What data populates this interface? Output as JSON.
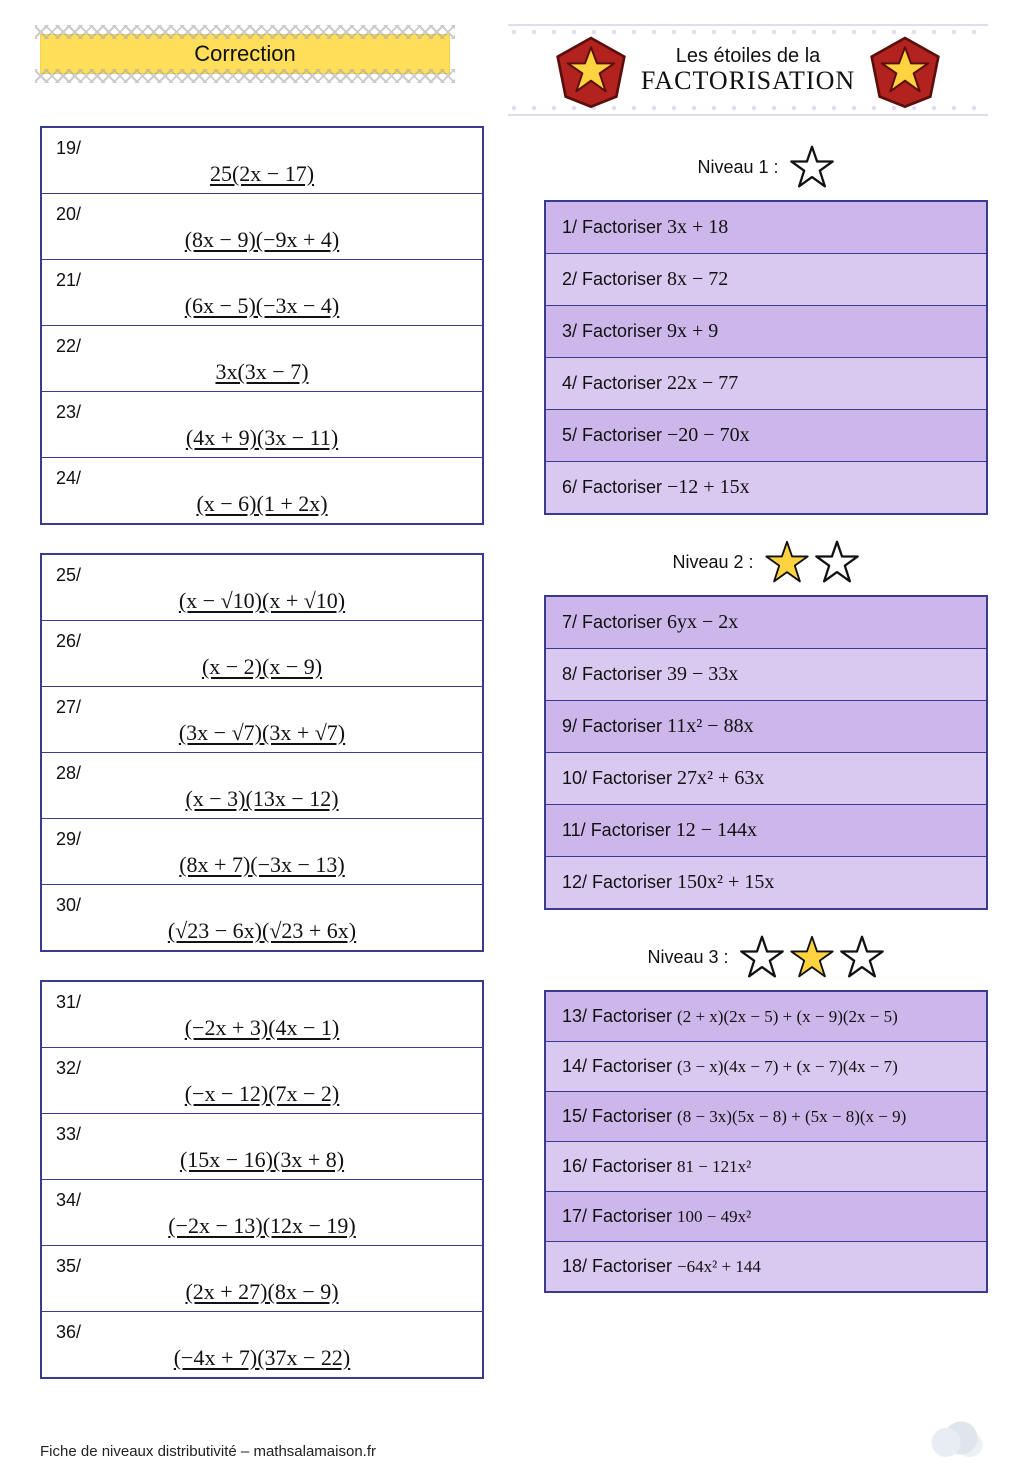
{
  "header": {
    "correction_label": "Correction",
    "title_line1": "Les étoiles de la",
    "title_line2": "FACTORISATION"
  },
  "niveaux": {
    "label1": "Niveau 1 :",
    "label2": "Niveau 2 :",
    "label3": "Niveau 3 :"
  },
  "answers_block1": [
    {
      "num": "19/",
      "expr": "25(2x − 17)"
    },
    {
      "num": "20/",
      "expr": "(8x − 9)(−9x + 4)"
    },
    {
      "num": "21/",
      "expr": "(6x − 5)(−3x − 4)"
    },
    {
      "num": "22/",
      "expr": "3x(3x − 7)"
    },
    {
      "num": "23/",
      "expr": "(4x + 9)(3x − 11)"
    },
    {
      "num": "24/",
      "expr": "(x − 6)(1 + 2x)"
    }
  ],
  "answers_block2": [
    {
      "num": "25/",
      "expr": "(x − √10)(x + √10)"
    },
    {
      "num": "26/",
      "expr": "(x − 2)(x − 9)"
    },
    {
      "num": "27/",
      "expr": "(3x − √7)(3x + √7)"
    },
    {
      "num": "28/",
      "expr": "(x − 3)(13x − 12)"
    },
    {
      "num": "29/",
      "expr": "(8x + 7)(−3x − 13)"
    },
    {
      "num": "30/",
      "expr": "(√23 − 6x)(√23 + 6x)"
    }
  ],
  "answers_block3": [
    {
      "num": "31/",
      "expr": "(−2x + 3)(4x − 1)"
    },
    {
      "num": "32/",
      "expr": "(−x − 12)(7x − 2)"
    },
    {
      "num": "33/",
      "expr": "(15x − 16)(3x + 8)"
    },
    {
      "num": "34/",
      "expr": "(−2x − 13)(12x − 19)"
    },
    {
      "num": "35/",
      "expr": "(2x + 27)(8x − 9)"
    },
    {
      "num": "36/",
      "expr": "(−4x + 7)(37x − 22)"
    }
  ],
  "level1": [
    {
      "label": "1/ Factoriser",
      "expr": "3x + 18"
    },
    {
      "label": "2/ Factoriser",
      "expr": "8x − 72"
    },
    {
      "label": "3/ Factoriser",
      "expr": "9x + 9"
    },
    {
      "label": "4/ Factoriser",
      "expr": "22x − 77"
    },
    {
      "label": "5/ Factoriser",
      "expr": "−20 − 70x"
    },
    {
      "label": "6/ Factoriser",
      "expr": "−12 + 15x"
    }
  ],
  "level2": [
    {
      "label": "7/ Factoriser",
      "expr": "6yx − 2x"
    },
    {
      "label": "8/ Factoriser",
      "expr": "39 − 33x"
    },
    {
      "label": "9/ Factoriser",
      "expr": "11x² − 88x"
    },
    {
      "label": "10/ Factoriser",
      "expr": "27x² + 63x"
    },
    {
      "label": "11/ Factoriser",
      "expr": "12 − 144x"
    },
    {
      "label": "12/ Factoriser",
      "expr": "150x² + 15x"
    }
  ],
  "level3": [
    {
      "label": "13/ Factoriser",
      "expr": "(2 + x)(2x − 5) + (x − 9)(2x − 5)"
    },
    {
      "label": "14/ Factoriser",
      "expr": "(3 − x)(4x − 7) + (x − 7)(4x − 7)"
    },
    {
      "label": "15/ Factoriser",
      "expr": "(8 − 3x)(5x − 8) + (5x − 8)(x − 9)"
    },
    {
      "label": "16/ Factoriser",
      "expr": "81 − 121x²"
    },
    {
      "label": "17/ Factoriser",
      "expr": "100 − 49x²"
    },
    {
      "label": "18/ Factoriser",
      "expr": "−64x² + 144"
    }
  ],
  "footer": {
    "text": "Fiche de niveaux distributivité  – mathsalamaison.fr"
  },
  "colors": {
    "banner": "#ffde59",
    "frame": "#3a3a8f",
    "row_odd": "#cdb7ea",
    "row_even": "#d9c9f0",
    "star_fill": "#ffd23f",
    "star_stroke": "#111",
    "badge_red": "#b2221f"
  }
}
